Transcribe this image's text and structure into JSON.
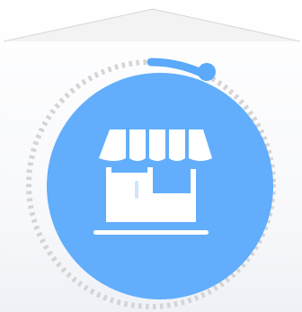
{
  "illustration": {
    "subject": "storefront-icon",
    "colors": {
      "circle": "#62aefc",
      "arc": "#5aa9fb",
      "dots": "#d4d4d4",
      "roof_top": "#f3f3f3",
      "roof_edge": "#d6d6d6",
      "icon": "#ffffff"
    }
  }
}
